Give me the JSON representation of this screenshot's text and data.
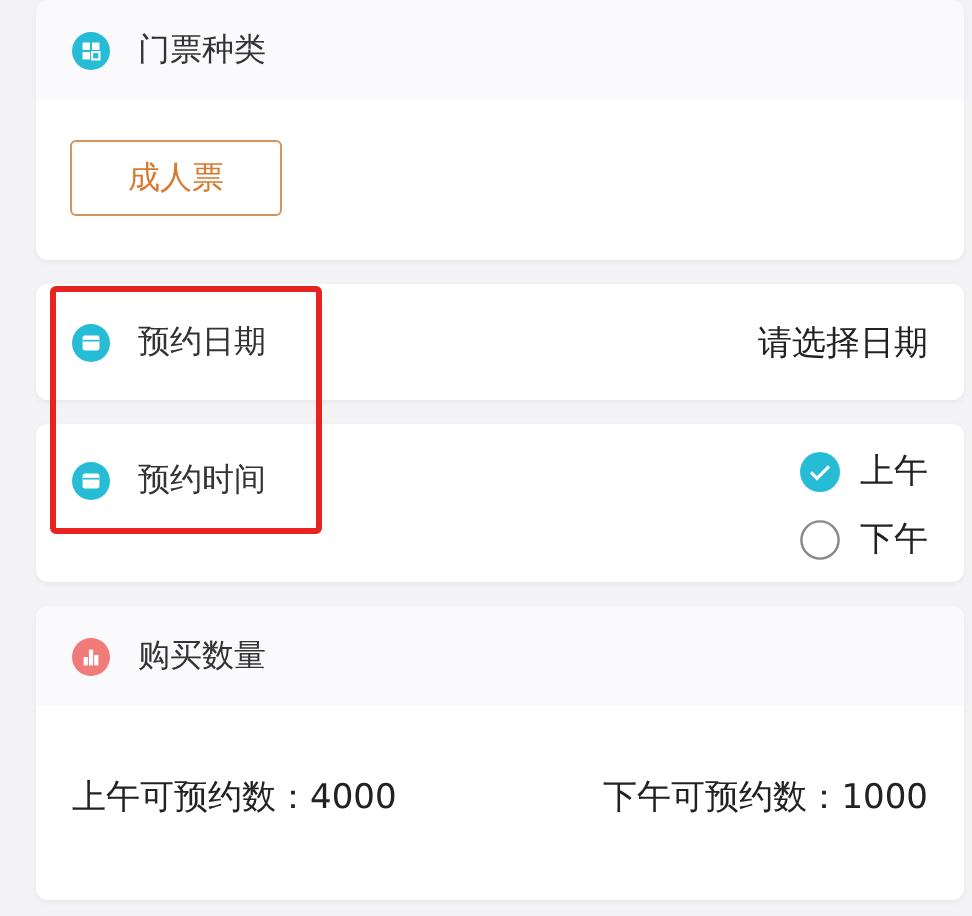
{
  "ticket_type": {
    "title": "门票种类",
    "options": [
      {
        "label": "成人票",
        "selected": true
      }
    ]
  },
  "date": {
    "label": "预约日期",
    "prompt": "请选择日期"
  },
  "time": {
    "label": "预约时间",
    "options": [
      {
        "label": "上午",
        "selected": true
      },
      {
        "label": "下午",
        "selected": false
      }
    ]
  },
  "quantity": {
    "title": "购买数量",
    "counts": [
      "上午可预约数：4000",
      "下午可预约数：1000"
    ]
  }
}
